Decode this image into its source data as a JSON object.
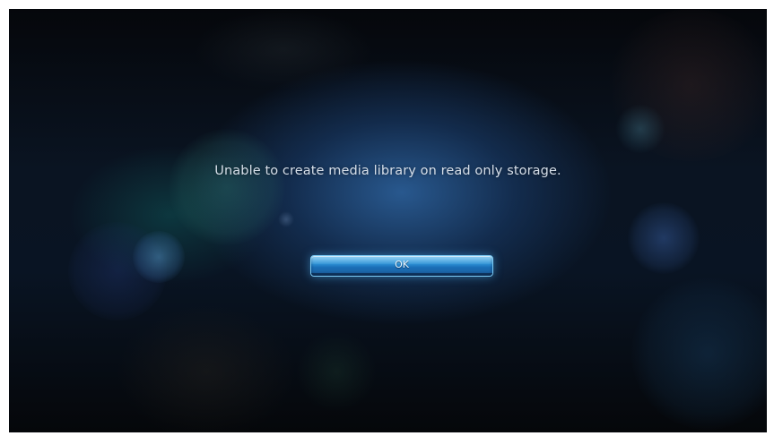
{
  "dialog": {
    "message": "Unable to create media library on read only storage.",
    "ok_label": "OK"
  },
  "colors": {
    "background_dark": "#06090f",
    "glow_blue": "#2a5c94",
    "button_blue": "#2e93d6",
    "text": "#d6dee8"
  }
}
